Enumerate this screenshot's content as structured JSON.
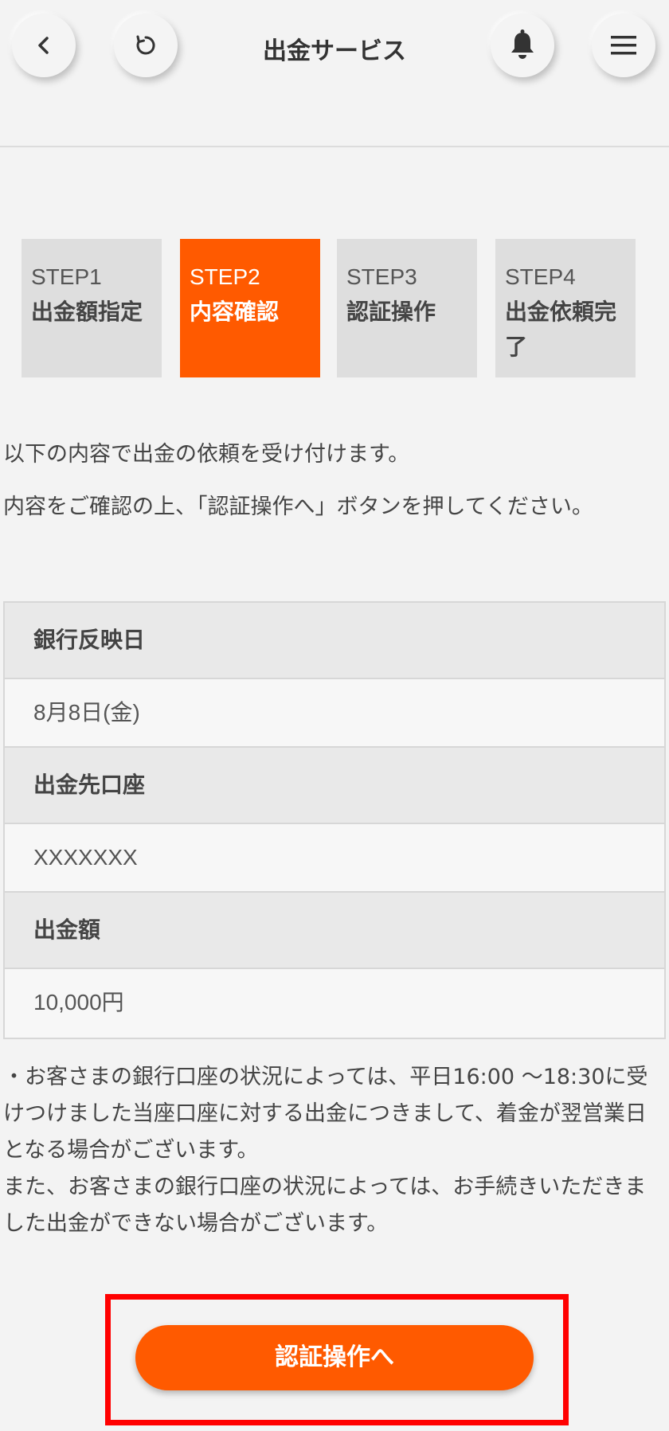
{
  "header": {
    "title": "出金サービス",
    "back_icon": "chevron-left-icon",
    "refresh_icon": "refresh-icon",
    "bell_icon": "bell-icon",
    "menu_icon": "hamburger-menu-icon"
  },
  "steps": [
    {
      "num": "STEP1",
      "label": "出金額指定",
      "active": false
    },
    {
      "num": "STEP2",
      "label": "内容確認",
      "active": true
    },
    {
      "num": "STEP3",
      "label": "認証操作",
      "active": false
    },
    {
      "num": "STEP4",
      "label": "出金依頼完了",
      "active": false
    }
  ],
  "intro": {
    "line1": "以下の内容で出金の依頼を受け付けます。",
    "line2": "内容をご確認の上、「認証操作へ」ボタンを押してください。"
  },
  "details": {
    "bank_date_label": "銀行反映日",
    "bank_date_value": "8月8日(金)",
    "account_label": "出金先口座",
    "account_value": "XXXXXXX",
    "amount_label": "出金額",
    "amount_value": "10,000円"
  },
  "notice": {
    "p1": "・お客さまの銀行口座の状況によっては、平日16:00 〜18:30に受けつけました当座口座に対する出金につきまして、着金が翌営業日となる場合がございます。",
    "p2": "また、お客さまの銀行口座の状況によっては、お手続きいただきました出金ができない場合がございます。"
  },
  "cta": {
    "label": "認証操作へ"
  },
  "colors": {
    "accent": "#ff5a00",
    "highlight": "#ff0000",
    "background": "#f3f3f3",
    "step_inactive": "#dedede"
  }
}
